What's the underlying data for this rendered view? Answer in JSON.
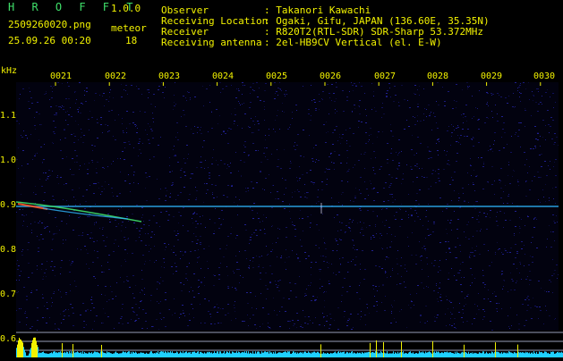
{
  "header": {
    "app_name": "H R O F F T",
    "version": "1.0.0",
    "filename": "2509260020.png",
    "datetime": "25.09.26 00:20",
    "meteor_label": "meteor",
    "meteor_count": "18",
    "observer_label": "Observer",
    "observer_value": ": Takanori Kawachi",
    "location_label": "Receiving Location",
    "location_value": ": Ogaki, Gifu, JAPAN (136.60E, 35.35N)",
    "receiver_label": "Receiver",
    "receiver_value": ": R820T2(RTL-SDR) SDR-Sharp 53.372MHz",
    "antenna_label": "Receiving antenna",
    "antenna_value": ": 2el-HB9CV Vertical (el. E-W)"
  },
  "axis": {
    "unit": "kHz",
    "time_ticks": [
      "0021",
      "0022",
      "0023",
      "0024",
      "0025",
      "0026",
      "0027",
      "0028",
      "0029",
      "0030"
    ],
    "freq_ticks": [
      "1.1",
      "1.0",
      "0.9",
      "0.8",
      "0.7",
      "0.6"
    ]
  },
  "colors": {
    "background": "#000000",
    "text_yellow": "#f2f200",
    "title_green": "#3fe06a",
    "signal_cyan": "#2fb8ff",
    "baseline_cyan": "#1fd0ff"
  }
}
